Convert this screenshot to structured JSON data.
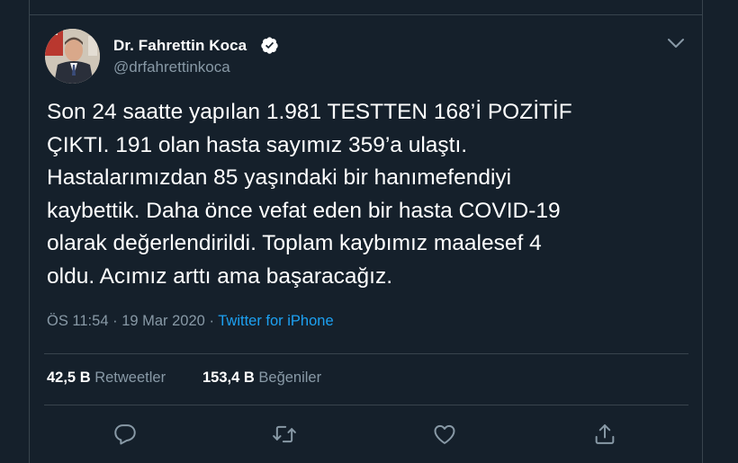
{
  "tweet": {
    "author": {
      "display_name": "Dr. Fahrettin Koca",
      "handle": "@drfahrettinkoca",
      "verified_icon": "verified-badge-icon",
      "avatar_icon": "avatar"
    },
    "text_lines": [
      "Son 24 saatte yapılan 1.981 TESTTEN 168’İ POZİTİF",
      "ÇIKTI. 191 olan hasta sayımız 359’a ulaştı.",
      "Hastalarımızdan 85 yaşındaki bir hanımefendiyi",
      "kaybettik. Daha önce vefat eden bir hasta COVID-19",
      "olarak değerlendirildi. Toplam kaybımız maalesef 4",
      "oldu. Acımız arttı ama başaracağız."
    ],
    "time": "ÖS 11:54",
    "date": "19 Mar 2020",
    "separator": "·",
    "source": "Twitter for iPhone",
    "stats": {
      "retweets_count": "42,5 B",
      "retweets_label": "Retweetler",
      "likes_count": "153,4 B",
      "likes_label": "Beğeniler"
    },
    "actions": [
      "reply-icon",
      "retweet-icon",
      "like-icon",
      "share-icon"
    ]
  },
  "colors": {
    "background": "#15202b",
    "border": "#38444d",
    "text": "#ffffff",
    "muted": "#8899a6",
    "accent": "#1da1f2"
  }
}
